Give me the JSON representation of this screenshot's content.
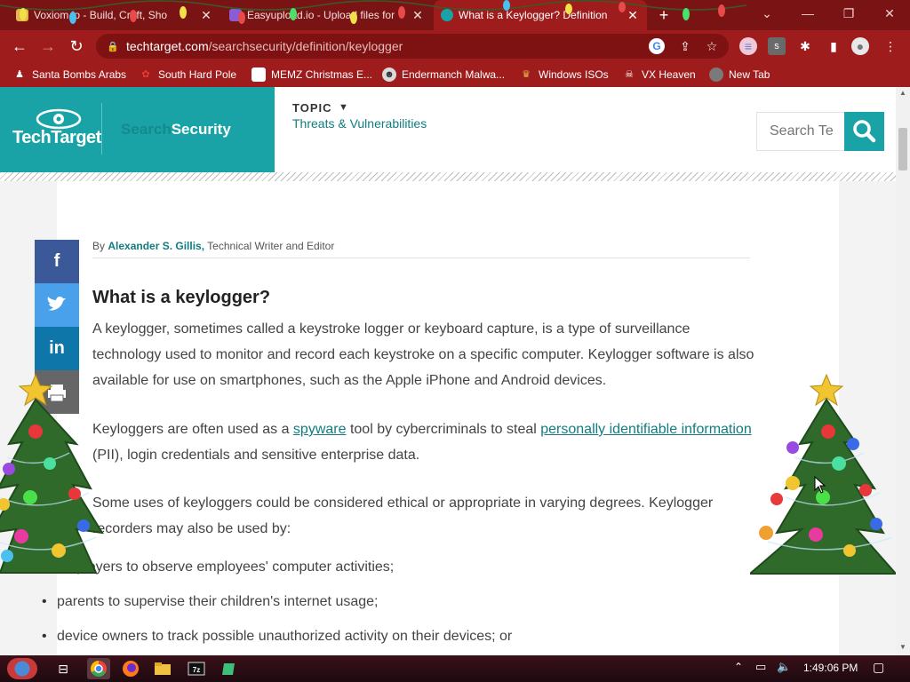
{
  "browser": {
    "tabs": [
      {
        "title": "Voxiom.io - Build, Craft, Sho",
        "active": false
      },
      {
        "title": "Easyupload.io - Upload files for",
        "active": false
      },
      {
        "title": "What is a Keylogger? Definition",
        "active": true
      }
    ],
    "new_tab_icon": "plus-icon",
    "url_domain": "techtarget.com",
    "url_path": "/searchsecurity/definition/keylogger",
    "bookmarks": [
      {
        "label": "Santa Bombs Arabs"
      },
      {
        "label": "South Hard Pole"
      },
      {
        "label": "MEMZ Christmas E..."
      },
      {
        "label": "Endermanch Malwa..."
      },
      {
        "label": "Windows ISOs"
      },
      {
        "label": "VX Heaven"
      },
      {
        "label": "New Tab"
      }
    ],
    "theme_colors": {
      "frame": "#7a1414",
      "toolbar": "#9e1c1c",
      "omnibox": "#7e1212"
    }
  },
  "site": {
    "logo_text": "TechTarget",
    "name_part1": "Search",
    "name_part2": "Security",
    "topic_label": "TOPIC",
    "topic_value": "Threats & Vulnerabilities",
    "search_placeholder": "Search Te",
    "accent_color": "#1aa3a6"
  },
  "article": {
    "byline_prefix": "By ",
    "author": "Alexander S. Gillis,",
    "author_role": " Technical Writer and Editor",
    "title": "What is a keylogger?",
    "p1": "A keylogger, sometimes called a keystroke logger or keyboard capture, is a type of surveillance technology used to monitor and record each keystroke on a specific computer. Keylogger software is also available for use on smartphones, such as the Apple iPhone and Android devices.",
    "p2_before": "Keyloggers are often used as a ",
    "p2_link1": "spyware",
    "p2_middle": " tool by cybercriminals to steal ",
    "p2_link2": "personally identifiable information",
    "p2_after": " (PII), login credentials and sensitive enterprise data.",
    "p3": "Some uses of keyloggers could be considered ethical or appropriate in varying degrees. Keylogger recorders may also be used by:",
    "list": [
      "employers to observe employees' computer activities;",
      "parents to supervise their children's internet usage;",
      "device owners to track possible unauthorized activity on their devices; or"
    ]
  },
  "share": [
    {
      "label": "f",
      "color": "#3b5998"
    },
    {
      "label": "in",
      "color": "#0e76a8"
    }
  ],
  "taskbar": {
    "time": "1:49:06 PM"
  }
}
